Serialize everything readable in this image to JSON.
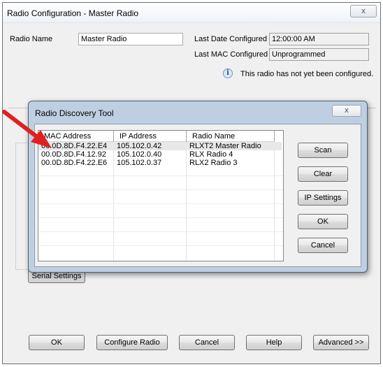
{
  "main_window": {
    "title": "Radio Configuration - Master Radio",
    "close_glyph": "ⅹ",
    "radio_name_label": "Radio Name",
    "radio_name_value": "Master Radio",
    "last_date_label": "Last Date Configured",
    "last_date_value": "12:00:00 AM",
    "last_mac_label": "Last MAC Configured",
    "last_mac_value": "Unprogrammed",
    "info_message": "This radio has not yet been configured.",
    "info_glyph": "i",
    "serial_settings_label": "Serial Settings",
    "buttons": {
      "ok": "OK",
      "configure": "Configure Radio",
      "cancel": "Cancel",
      "help": "Help",
      "advanced": "Advanced >>"
    }
  },
  "discovery_dialog": {
    "title": "Radio Discovery Tool",
    "close_glyph": "ⅹ",
    "columns": [
      "MAC Address",
      "IP Address",
      "Radio Name"
    ],
    "rows": [
      [
        "00.0D.8D.F4.22.E4",
        "105.102.0.42",
        "RLXT2 Master Radio"
      ],
      [
        "00.0D.8D.F4.12.92",
        "105.102.0.40",
        "RLX Radio 4"
      ],
      [
        "00.0D.8D.F4.22.E6",
        "105.102.0.37",
        "RLX2 Radio 3"
      ]
    ],
    "buttons": {
      "scan": "Scan",
      "clear": "Clear",
      "ip_settings": "IP Settings",
      "ok": "OK",
      "cancel": "Cancel"
    }
  },
  "colors": {
    "annotation_arrow": "#e02020",
    "dialog_frame": "#bfcfe2"
  }
}
